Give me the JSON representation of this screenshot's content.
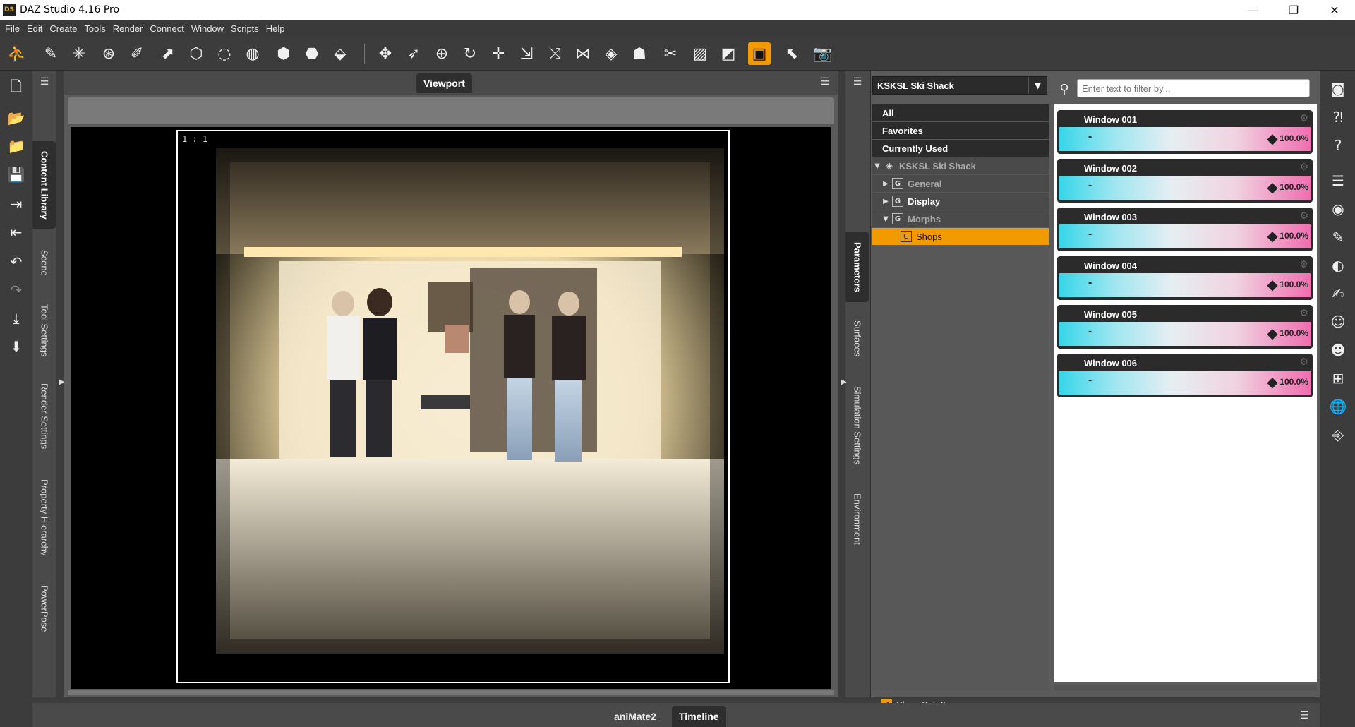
{
  "window": {
    "title": "DAZ Studio 4.16 Pro",
    "app_icon_text": "DS",
    "minimize": "—",
    "restore": "❐",
    "close": "✕"
  },
  "menus": [
    "File",
    "Edit",
    "Create",
    "Tools",
    "Render",
    "Connect",
    "Window",
    "Scripts",
    "Help"
  ],
  "left_tabs": [
    "Content Library",
    "Scene",
    "Tool Settings",
    "Render Settings",
    "Property Hierarchy",
    "PowerPose"
  ],
  "viewport": {
    "tab_label": "Viewport",
    "ratio_label": "1 : 1"
  },
  "right_tabs": [
    "Parameters",
    "Surfaces",
    "Simulation Settings",
    "Environment"
  ],
  "parameters": {
    "node": "KSKSL Ski Shack",
    "filter_placeholder": "Enter text to filter by...",
    "tree": {
      "all": "All",
      "favorites": "Favorites",
      "currently_used": "Currently Used",
      "root": "KSKSL Ski Shack",
      "general": "General",
      "display": "Display",
      "morphs": "Morphs",
      "shops": "Shops"
    },
    "show_sub_items": "Show Sub Items",
    "items": [
      {
        "name": "Window 001",
        "value": "100.0%"
      },
      {
        "name": "Window 002",
        "value": "100.0%"
      },
      {
        "name": "Window 003",
        "value": "100.0%"
      },
      {
        "name": "Window 004",
        "value": "100.0%"
      },
      {
        "name": "Window 005",
        "value": "100.0%"
      },
      {
        "name": "Window 006",
        "value": "100.0%"
      }
    ]
  },
  "bottom_tabs": {
    "animate": "aniMate2",
    "timeline": "Timeline"
  },
  "colors": {
    "accent": "#f29a00",
    "panel_dark": "#2b2b2b",
    "panel": "#5b5b5b"
  }
}
